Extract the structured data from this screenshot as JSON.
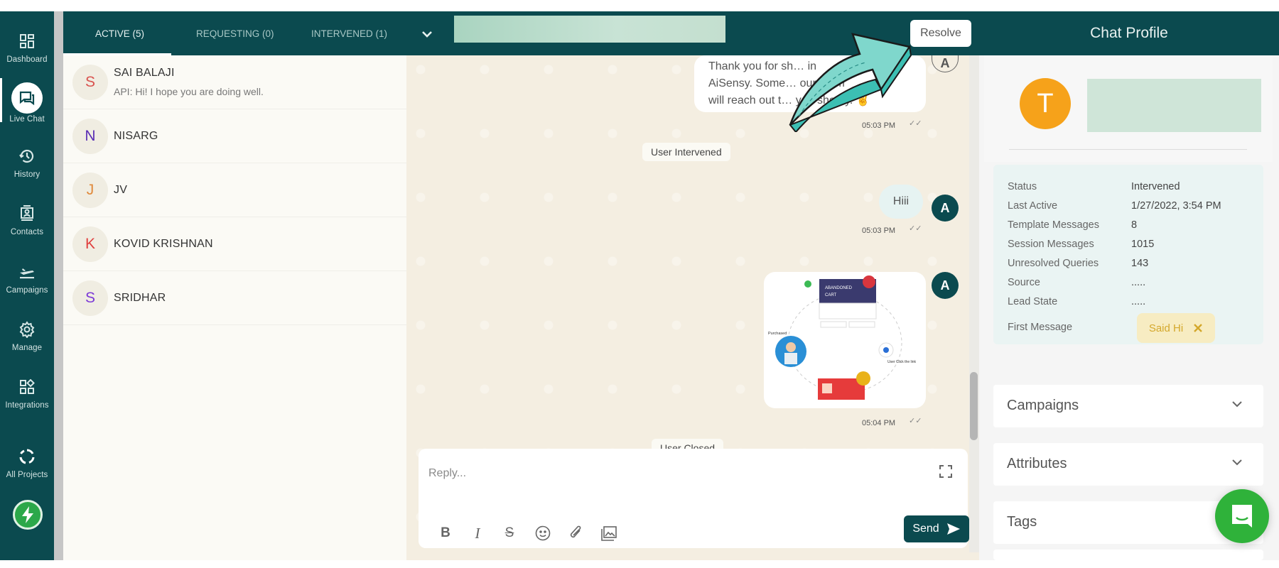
{
  "sidebar": {
    "items": [
      {
        "label": "Dashboard",
        "icon": "dashboard-icon"
      },
      {
        "label": "Live Chat",
        "icon": "chat-icon",
        "active": true
      },
      {
        "label": "History",
        "icon": "history-icon"
      },
      {
        "label": "Contacts",
        "icon": "contacts-icon"
      },
      {
        "label": "Campaigns",
        "icon": "campaign-plane-icon"
      },
      {
        "label": "Manage",
        "icon": "gear-icon"
      },
      {
        "label": "Integrations",
        "icon": "integrations-icon"
      },
      {
        "label": "All Projects",
        "icon": "projects-ring-icon"
      }
    ],
    "logo_icon": "bolt-logo-icon"
  },
  "tabs": [
    {
      "label": "ACTIVE (5)",
      "active": true
    },
    {
      "label": "REQUESTING (0)"
    },
    {
      "label": "INTERVENED (1)"
    }
  ],
  "chats": [
    {
      "initial": "S",
      "name": "SAI BALAJI",
      "preview": "API: Hi! I hope you are doing well.",
      "color": "#d9534f"
    },
    {
      "initial": "N",
      "name": "NISARG",
      "preview": "",
      "color": "#5b2fb5"
    },
    {
      "initial": "J",
      "name": "JV",
      "preview": "",
      "color": "#e08a3c"
    },
    {
      "initial": "K",
      "name": "KOVID KRISHNAN",
      "preview": "",
      "color": "#e0403f"
    },
    {
      "initial": "S",
      "name": "SRIDHAR",
      "preview": "",
      "color": "#7c3ad6"
    }
  ],
  "header": {
    "resolve_label": "Resolve"
  },
  "conversation": {
    "messages": [
      {
        "type": "agent",
        "text_lines": [
          "Thank you for sh… in",
          "AiSensy. Some… our team",
          "will reach out t… you shortly. ✌"
        ],
        "time": "05:03 PM",
        "agent_initial": "A"
      },
      {
        "type": "system",
        "text": "User Intervened"
      },
      {
        "type": "agent",
        "text": "Hiii",
        "time": "05:03 PM",
        "agent_initial": "A"
      },
      {
        "type": "agent-image",
        "caption": "Abandoned cart flow illustration",
        "image_labels": [
          "ABANDONED CART",
          "Purchased",
          "User Click the link"
        ],
        "time": "05:04 PM",
        "agent_initial": "A"
      },
      {
        "type": "system",
        "text": "User Closed"
      }
    ]
  },
  "composer": {
    "placeholder": "Reply...",
    "value": "",
    "send_label": "Send",
    "format_buttons": [
      "bold-icon",
      "italic-icon",
      "strikethrough-icon",
      "emoji-icon",
      "attachment-icon",
      "media-gallery-icon"
    ]
  },
  "profile": {
    "title": "Chat Profile",
    "avatar_initial": "T",
    "avatar_color": "#f6a21a",
    "info": [
      {
        "label": "Status",
        "value": "Intervened"
      },
      {
        "label": "Last Active",
        "value": "1/27/2022, 3:54 PM"
      },
      {
        "label": "Template Messages",
        "value": "8"
      },
      {
        "label": "Session Messages",
        "value": "1015"
      },
      {
        "label": "Unresolved Queries",
        "value": "143"
      },
      {
        "label": "Source",
        "value": "....."
      },
      {
        "label": "Lead State",
        "value": "....."
      },
      {
        "label": "First Message",
        "value": ""
      }
    ],
    "first_message_tag": "Said Hi",
    "sections": [
      "Campaigns",
      "Attributes",
      "Tags"
    ]
  },
  "colors": {
    "brand_dark": "#0b4a4f",
    "help_green": "#2fb23a",
    "tag_text": "#d4a82c"
  }
}
